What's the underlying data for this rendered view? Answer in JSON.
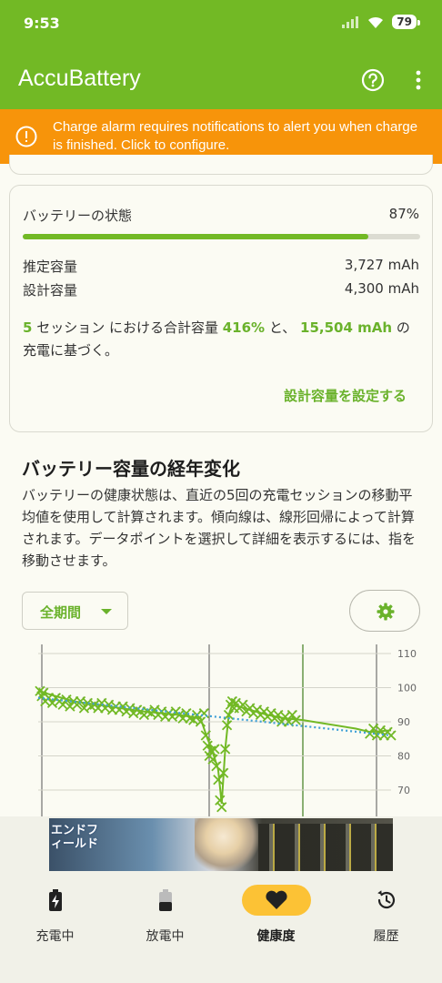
{
  "status_bar": {
    "time": "9:53",
    "battery": "79"
  },
  "app_bar": {
    "title": "AccuBattery"
  },
  "alert": {
    "text": "Charge alarm requires notifications to alert you when charge is finished. Click to configure."
  },
  "health_card": {
    "state_label": "バッテリーの状態",
    "state_value": "87%",
    "health_fraction": 0.87,
    "estimated_label": "推定容量",
    "estimated_value": "3,727 mAh",
    "design_label": "設計容量",
    "design_value": "4,300 mAh",
    "summary": {
      "sessions": "5",
      "part1": " セッション における合計容量 ",
      "percent": "416%",
      "part2": " と、 ",
      "mah": "15,504 mAh",
      "part3": " の",
      "line2": "充電に基づく。"
    },
    "set_capacity_button": "設計容量を設定する"
  },
  "wear_section": {
    "title": "バッテリー容量の経年変化",
    "description": "バッテリーの健康状態は、直近の5回の充電セッションの移動平均値を使用して計算されます。傾向線は、線形回帰によって計算されます。データポイントを選択して詳細を表示するには、指を移動させます。",
    "period_dropdown": "全期間"
  },
  "chart_data": {
    "type": "scatter",
    "y_ticks": [
      "110",
      "100",
      "90",
      "80",
      "70"
    ],
    "ylim": [
      64,
      113
    ],
    "xlim": [
      0,
      100
    ],
    "points": [
      [
        0.5,
        99
      ],
      [
        1,
        97.5
      ],
      [
        1.5,
        98.5
      ],
      [
        2,
        96
      ],
      [
        3,
        97
      ],
      [
        4,
        95.5
      ],
      [
        5,
        97
      ],
      [
        6,
        96
      ],
      [
        7,
        95
      ],
      [
        8,
        96.5
      ],
      [
        9,
        94.5
      ],
      [
        10,
        96
      ],
      [
        11,
        95
      ],
      [
        12,
        96
      ],
      [
        13,
        94
      ],
      [
        14,
        95.5
      ],
      [
        15,
        94.5
      ],
      [
        16,
        95
      ],
      [
        17,
        94
      ],
      [
        18,
        95.5
      ],
      [
        19,
        94
      ],
      [
        20,
        95
      ],
      [
        21,
        93.5
      ],
      [
        22,
        94.5
      ],
      [
        23,
        93.5
      ],
      [
        24,
        94.5
      ],
      [
        25,
        93
      ],
      [
        26,
        94
      ],
      [
        27,
        92.5
      ],
      [
        28,
        93.5
      ],
      [
        29,
        93
      ],
      [
        30,
        92
      ],
      [
        31,
        93
      ],
      [
        32,
        92.5
      ],
      [
        33,
        93.5
      ],
      [
        34,
        92
      ],
      [
        35,
        93
      ],
      [
        36,
        91.5
      ],
      [
        37,
        92.5
      ],
      [
        38,
        91.5
      ],
      [
        39,
        93
      ],
      [
        40,
        92
      ],
      [
        41,
        91
      ],
      [
        42,
        92.5
      ],
      [
        43,
        91
      ],
      [
        44,
        90.5
      ],
      [
        45,
        92
      ],
      [
        46,
        90
      ],
      [
        47,
        92.5
      ],
      [
        47.5,
        86
      ],
      [
        48,
        83
      ],
      [
        48.5,
        80
      ],
      [
        49,
        81.5
      ],
      [
        49.5,
        79
      ],
      [
        50,
        82
      ],
      [
        50.5,
        77
      ],
      [
        51,
        73
      ],
      [
        51.5,
        67
      ],
      [
        52,
        65
      ],
      [
        52.5,
        75
      ],
      [
        53,
        82
      ],
      [
        53.5,
        89
      ],
      [
        54,
        92
      ],
      [
        54.5,
        95
      ],
      [
        55,
        96
      ],
      [
        55.5,
        94
      ],
      [
        56,
        95.5
      ],
      [
        57,
        94
      ],
      [
        58,
        95
      ],
      [
        59,
        93
      ],
      [
        60,
        94
      ],
      [
        61,
        92.5
      ],
      [
        62,
        93.5
      ],
      [
        63,
        92
      ],
      [
        64,
        93
      ],
      [
        65,
        91.5
      ],
      [
        66,
        92.5
      ],
      [
        67,
        91
      ],
      [
        68,
        92
      ],
      [
        69,
        90
      ],
      [
        70,
        91.5
      ],
      [
        71,
        90
      ],
      [
        72,
        92
      ],
      [
        73,
        90.5
      ],
      [
        94,
        86.5
      ],
      [
        95,
        88
      ],
      [
        96,
        86
      ],
      [
        97,
        87.5
      ],
      [
        98,
        86
      ],
      [
        99,
        87
      ],
      [
        100,
        86
      ]
    ],
    "trend": [
      [
        0,
        97
      ],
      [
        100,
        86
      ]
    ],
    "avg": [
      [
        0,
        99
      ],
      [
        10,
        96
      ],
      [
        20,
        94.5
      ],
      [
        30,
        93
      ],
      [
        40,
        92
      ],
      [
        46,
        91
      ],
      [
        48,
        85
      ],
      [
        49.5,
        81
      ],
      [
        51,
        76
      ],
      [
        52,
        66
      ],
      [
        53,
        82
      ],
      [
        54,
        92
      ],
      [
        55,
        95
      ],
      [
        60,
        93.5
      ],
      [
        65,
        92
      ],
      [
        70,
        91
      ],
      [
        75,
        90.5
      ],
      [
        90,
        88
      ],
      [
        94,
        87
      ],
      [
        100,
        87.5
      ]
    ]
  },
  "ad": {
    "logo_text": "エンドフィールド"
  },
  "bottom_nav": {
    "items": [
      {
        "label": "充電中",
        "icon": "battery-charging-icon"
      },
      {
        "label": "放電中",
        "icon": "battery-discharging-icon"
      },
      {
        "label": "健康度",
        "icon": "heart-icon"
      },
      {
        "label": "履歴",
        "icon": "history-icon"
      }
    ],
    "active_index": 2
  },
  "colors": {
    "accent": "#72b925",
    "alert": "#f7940a",
    "nav_active": "#fcc235",
    "trend": "#3fa0d6"
  }
}
